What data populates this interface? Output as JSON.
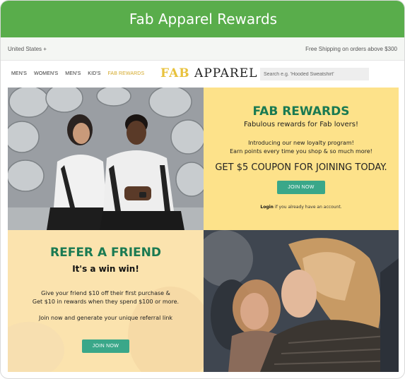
{
  "banner": {
    "title": "Fab Apparel Rewards"
  },
  "utility": {
    "country": "United States +",
    "shipping": "Free Shipping on orders above $300"
  },
  "nav": {
    "links": [
      {
        "label": "MEN'S"
      },
      {
        "label": "WOMEN'S"
      },
      {
        "label": "MEN'S"
      },
      {
        "label": "KID'S"
      },
      {
        "label": "FAB REWARDS"
      }
    ],
    "logo_prefix": "FAB",
    "logo_suffix": "APPAREL",
    "search_placeholder": "Search e.g. 'Hooded Sweatshirt'"
  },
  "rewards": {
    "title": "FAB REWARDS",
    "subtitle": "Fabulous rewards for Fab lovers!",
    "intro_line1": "Introducing our new loyalty program!",
    "intro_line2": "Earn points every time you shop & so much more!",
    "coupon": "GET $5 COUPON FOR JOINING TODAY.",
    "join_button": "JOIN NOW",
    "login_link": "Login",
    "login_text": " if you already have an account."
  },
  "refer": {
    "title": "REFER A FRIEND",
    "subtitle": "It's a win win!",
    "give_line1": "Give your friend $10 off their first purchase &",
    "give_line2": "Get $10 in rewards when they spend $100 or more.",
    "join_text": "Join now and generate your unique referral link",
    "join_button": "JOIN NOW"
  },
  "colors": {
    "banner": "#59ad4b",
    "accent_green": "#1a7a52",
    "button": "#3aa789",
    "logo_yellow": "#e8c23d",
    "rewards_bg": "#fde28a"
  }
}
